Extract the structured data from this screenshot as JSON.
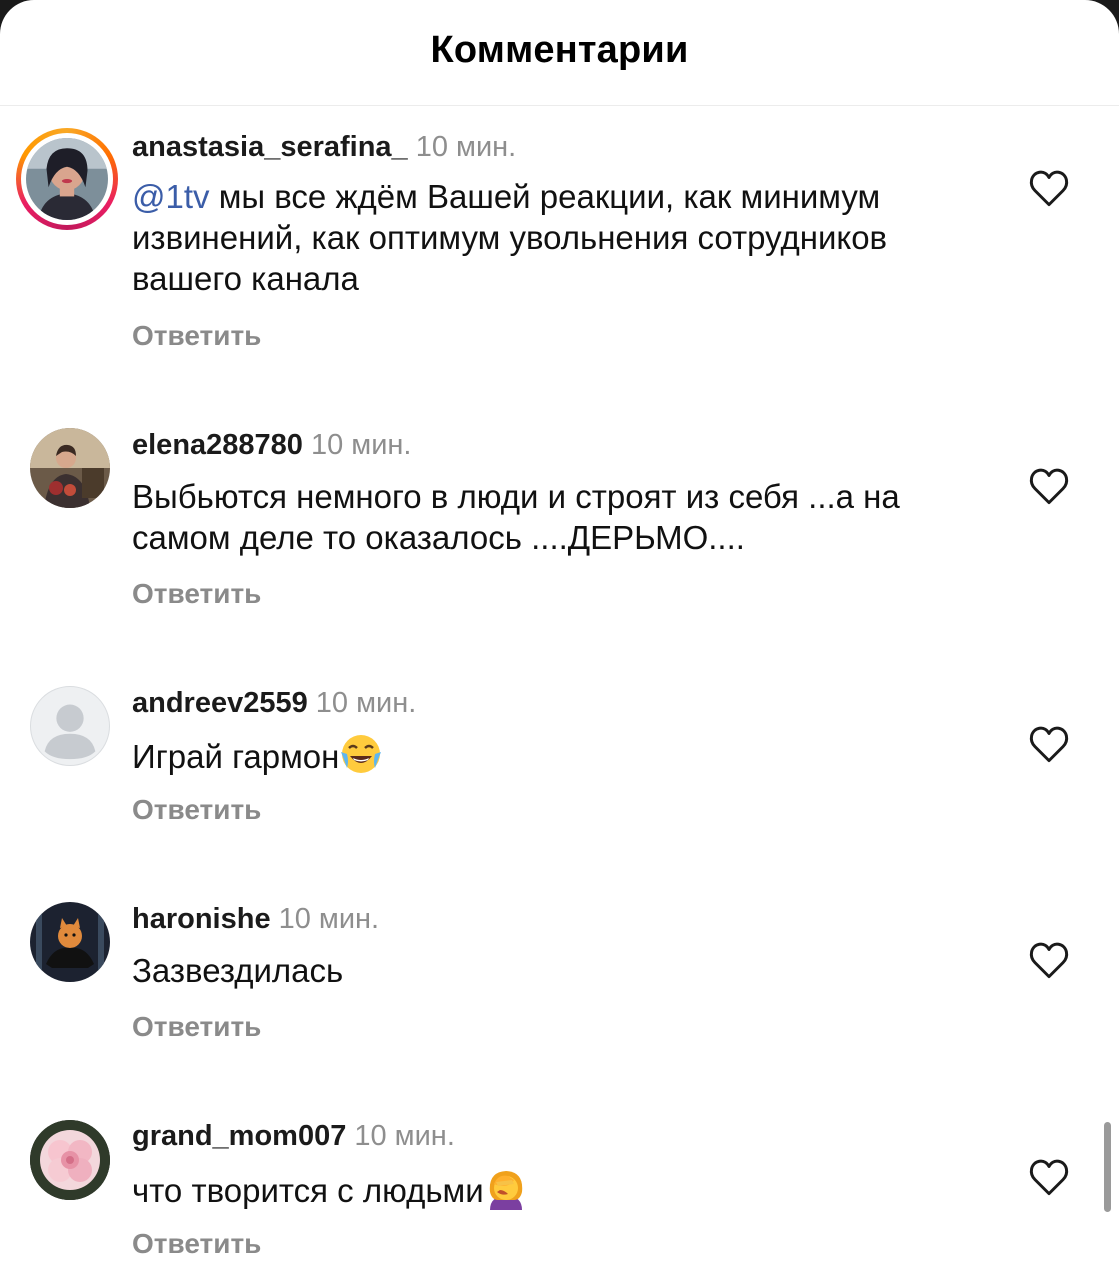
{
  "header": {
    "title": "Комментарии"
  },
  "comments": [
    {
      "username": "anastasia_serafina_",
      "time": "10 мин.",
      "mention": "@1tv",
      "text": " мы все ждём Вашей реакции,  как минимум извинений,  как оптимум увольнения сотрудников вашего канала",
      "reply_label": "Ответить",
      "has_story_ring": true
    },
    {
      "username": "elena288780",
      "time": "10 мин.",
      "text": "Выбьются немного в люди и строят из себя ...а на самом деле то оказалось ....ДЕРЬМО....",
      "reply_label": "Ответить"
    },
    {
      "username": "andreev2559",
      "time": "10 мин.",
      "text": "Играй гармон",
      "emoji": "face-with-tears-of-joy",
      "reply_label": "Ответить"
    },
    {
      "username": "haronishe",
      "time": "10 мин.",
      "text": "Зазвездилась",
      "reply_label": "Ответить"
    },
    {
      "username": "grand_mom007",
      "time": "10 мин.",
      "text": "что творится с людьми",
      "emoji": "woman-facepalming",
      "reply_label": "Ответить"
    }
  ],
  "icons": {
    "like": "heart-outline-icon"
  },
  "colors": {
    "mention": "#3b5da8",
    "secondary_text": "#8e8e8e",
    "reply": "#8a8a8a"
  }
}
